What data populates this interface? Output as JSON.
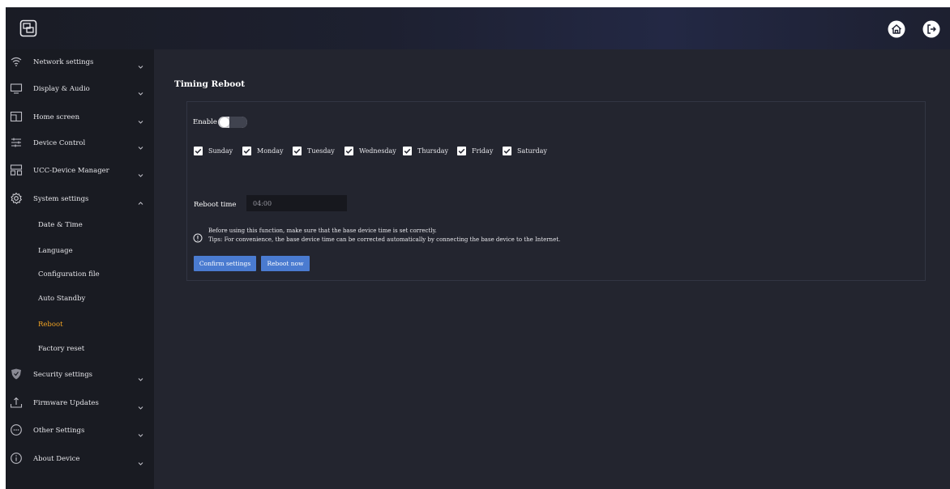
{
  "header": {
    "logo_icon": "screen-share-icon",
    "home_icon": "home-icon",
    "logout_icon": "logout-icon"
  },
  "sidebar": {
    "items": [
      {
        "label": "Network settings",
        "icon": "wifi-icon"
      },
      {
        "label": "Display & Audio",
        "icon": "monitor-icon"
      },
      {
        "label": "Home screen",
        "icon": "home-screen-icon"
      },
      {
        "label": "Device Control",
        "icon": "sliders-icon"
      },
      {
        "label": "UCC-Device Manager",
        "icon": "device-manager-icon"
      },
      {
        "label": "System settings",
        "icon": "gear-icon"
      },
      {
        "label": "Security settings",
        "icon": "shield-icon"
      },
      {
        "label": "Firmware Updates",
        "icon": "upload-icon"
      },
      {
        "label": "Other Settings",
        "icon": "more-icon"
      },
      {
        "label": "About Device",
        "icon": "info-icon"
      }
    ],
    "system_sub_items": [
      {
        "label": "Date & Time"
      },
      {
        "label": "Language"
      },
      {
        "label": "Configuration file"
      },
      {
        "label": "Auto Standby"
      },
      {
        "label": "Reboot",
        "active": true
      },
      {
        "label": "Factory reset"
      }
    ]
  },
  "main": {
    "title": "Timing Reboot",
    "enable_label": "Enable",
    "enable_on": false,
    "days": [
      {
        "label": "Sunday",
        "checked": true
      },
      {
        "label": "Monday",
        "checked": true
      },
      {
        "label": "Tuesday",
        "checked": true
      },
      {
        "label": "Wednesday",
        "checked": true
      },
      {
        "label": "Thursday",
        "checked": true
      },
      {
        "label": "Friday",
        "checked": true
      },
      {
        "label": "Saturday",
        "checked": true
      }
    ],
    "reboot_time_label": "Reboot time",
    "reboot_time_value": "04:00",
    "info_line1": "Before using this function, make sure that the base device time is set correctly.",
    "info_line2": "Tips: For convenience, the base device time can be corrected automatically by connecting the base device to the Internet.",
    "confirm_label": "Confirm settings",
    "reboot_now_label": "Reboot now"
  },
  "colors": {
    "accent": "#4a7bd0",
    "active_sub": "#f5a623",
    "background": "#23252f",
    "sidebar": "#191b22"
  }
}
